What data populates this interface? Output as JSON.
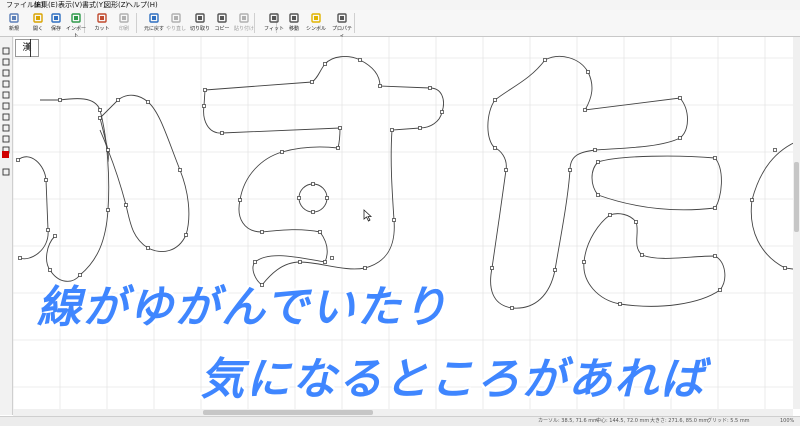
{
  "menubar": {
    "items": [
      "ファイル(F)",
      "編集(E)",
      "表示(V)",
      "書式(Y)",
      "図形(Z)",
      "ヘルプ(H)"
    ]
  },
  "toolbar": {
    "buttons": [
      {
        "label": "新規",
        "icon": "new-file-icon",
        "enabled": true
      },
      {
        "label": "開く",
        "icon": "open-folder-icon",
        "enabled": true
      },
      {
        "label": "保存",
        "icon": "save-icon",
        "enabled": true
      },
      {
        "label": "インポート",
        "icon": "import-icon",
        "enabled": true
      },
      {
        "label": "カット",
        "icon": "cut-icon",
        "enabled": true
      },
      {
        "label": "印刷",
        "icon": "print-icon",
        "enabled": false
      },
      {
        "label": "元に戻す",
        "icon": "undo-icon",
        "enabled": true
      },
      {
        "label": "やり直し",
        "icon": "redo-icon",
        "enabled": false
      },
      {
        "label": "切り取り",
        "icon": "cut-doc-icon",
        "enabled": true
      },
      {
        "label": "コピー",
        "icon": "copy-icon",
        "enabled": true
      },
      {
        "label": "貼り付け",
        "icon": "paste-icon",
        "enabled": false
      },
      {
        "label": "フィット",
        "icon": "fit-icon",
        "enabled": true
      },
      {
        "label": "移動",
        "icon": "move-icon",
        "enabled": true
      },
      {
        "label": "シンボル",
        "icon": "star-symbol-icon",
        "enabled": true
      },
      {
        "label": "プロパティ",
        "icon": "properties-icon",
        "enabled": true
      }
    ]
  },
  "lefttools": {
    "tools": [
      "pointer-icon",
      "node-edit-icon",
      "zoom-icon",
      "text-icon",
      "rectangle-icon",
      "ellipse-icon",
      "polygon-icon",
      "star-icon",
      "pen-icon",
      "freehand-icon",
      "color-swatch-icon",
      "crop-icon"
    ],
    "swatch_color": "#d00000"
  },
  "canvas": {
    "glyph_text": "かすた",
    "thumb_label": "漢"
  },
  "subtitles": {
    "line1": "線がゆがんでいたり",
    "line2": "気になるところがあれば",
    "color": "#3f86ff"
  },
  "statusbar": {
    "cursor": "カーソル: 38.5, 71.6 mm",
    "center": "中心: 144.5, 72.0 mm",
    "size": "大きさ: 271.6, 85.0 mm",
    "grid": "グリッド: 5.5 mm",
    "zoom": "100%"
  }
}
